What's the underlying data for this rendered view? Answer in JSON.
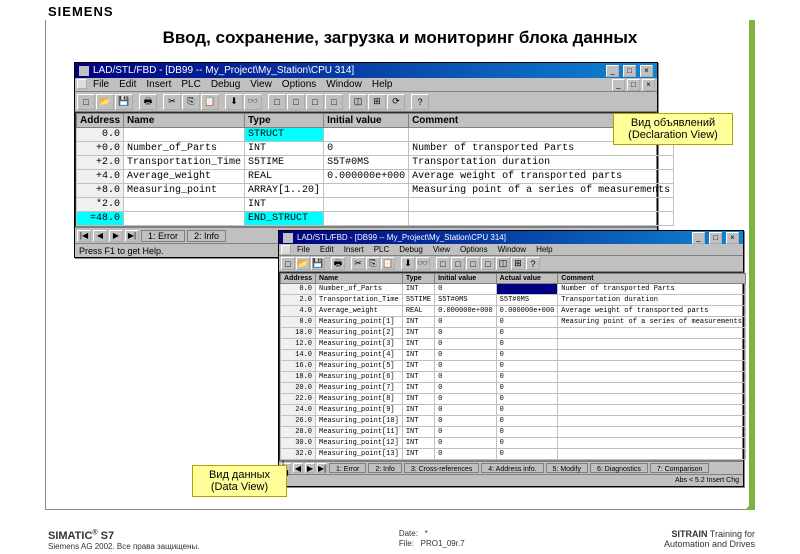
{
  "brand": "SIEMENS",
  "title": "Ввод, сохранение, загрузка и мониторинг блока данных",
  "win1": {
    "title": "LAD/STL/FBD  - [DB99 -- My_Project\\My_Station\\CPU 314]",
    "menu": [
      "File",
      "Edit",
      "Insert",
      "PLC",
      "Debug",
      "View",
      "Options",
      "Window",
      "Help"
    ],
    "cols": [
      "Address",
      "Name",
      "Type",
      "Initial value",
      "Comment"
    ],
    "rows": [
      {
        "addr": "0.0",
        "name": "",
        "type": "STRUCT",
        "init": "",
        "comment": ""
      },
      {
        "addr": "+0.0",
        "name": "Number_of_Parts",
        "type": "INT",
        "init": "0",
        "comment": "Number of transported Parts"
      },
      {
        "addr": "+2.0",
        "name": "Transportation_Time",
        "type": "S5TIME",
        "init": "S5T#0MS",
        "comment": "Transportation duration"
      },
      {
        "addr": "+4.0",
        "name": "Average_weight",
        "type": "REAL",
        "init": "0.000000e+000",
        "comment": "Average weight of transported parts"
      },
      {
        "addr": "+8.0",
        "name": "Measuring_point",
        "type": "ARRAY[1..20]",
        "init": "",
        "comment": "Measuring point of a series of measurements"
      },
      {
        "addr": "*2.0",
        "name": "",
        "type": "INT",
        "init": "",
        "comment": ""
      },
      {
        "addr": "=48.0",
        "name": "",
        "type": "END_STRUCT",
        "init": "",
        "comment": ""
      }
    ],
    "tabs": [
      "1: Error",
      "2: Info"
    ],
    "status": "Press F1 to get Help."
  },
  "win2": {
    "title": "LAD/STL/FBD  - [DB99 -- My_Project\\My_Station\\CPU 314]",
    "menu": [
      "File",
      "Edit",
      "Insert",
      "PLC",
      "Debug",
      "View",
      "Options",
      "Window",
      "Help"
    ],
    "cols": [
      "Address",
      "Name",
      "Type",
      "Initial value",
      "Actual value",
      "Comment"
    ],
    "rows": [
      {
        "addr": "0.0",
        "name": "Number_of_Parts",
        "type": "INT",
        "init": "0",
        "act": "",
        "comment": "Number of transported Parts"
      },
      {
        "addr": "2.0",
        "name": "Transportation_Time",
        "type": "S5TIME",
        "init": "S5T#0MS",
        "act": "S5T#0MS",
        "comment": "Transportation duration"
      },
      {
        "addr": "4.0",
        "name": "Average_weight",
        "type": "REAL",
        "init": "0.000000e+000",
        "act": "0.000000e+000",
        "comment": "Average weight of transported parts"
      },
      {
        "addr": "8.0",
        "name": "Measuring_point[1]",
        "type": "INT",
        "init": "0",
        "act": "0",
        "comment": "Measuring point of a series of measurements"
      },
      {
        "addr": "10.0",
        "name": "Measuring_point[2]",
        "type": "INT",
        "init": "0",
        "act": "0",
        "comment": ""
      },
      {
        "addr": "12.0",
        "name": "Measuring_point[3]",
        "type": "INT",
        "init": "0",
        "act": "0",
        "comment": ""
      },
      {
        "addr": "14.0",
        "name": "Measuring_point[4]",
        "type": "INT",
        "init": "0",
        "act": "0",
        "comment": ""
      },
      {
        "addr": "16.0",
        "name": "Measuring_point[5]",
        "type": "INT",
        "init": "0",
        "act": "0",
        "comment": ""
      },
      {
        "addr": "18.0",
        "name": "Measuring_point[6]",
        "type": "INT",
        "init": "0",
        "act": "0",
        "comment": ""
      },
      {
        "addr": "20.0",
        "name": "Measuring_point[7]",
        "type": "INT",
        "init": "0",
        "act": "0",
        "comment": ""
      },
      {
        "addr": "22.0",
        "name": "Measuring_point[8]",
        "type": "INT",
        "init": "0",
        "act": "0",
        "comment": ""
      },
      {
        "addr": "24.0",
        "name": "Measuring_point[9]",
        "type": "INT",
        "init": "0",
        "act": "0",
        "comment": ""
      },
      {
        "addr": "26.0",
        "name": "Measuring_point[10]",
        "type": "INT",
        "init": "0",
        "act": "0",
        "comment": ""
      },
      {
        "addr": "28.0",
        "name": "Measuring_point[11]",
        "type": "INT",
        "init": "0",
        "act": "0",
        "comment": ""
      },
      {
        "addr": "30.0",
        "name": "Measuring_point[12]",
        "type": "INT",
        "init": "0",
        "act": "0",
        "comment": ""
      },
      {
        "addr": "32.0",
        "name": "Measuring_point[13]",
        "type": "INT",
        "init": "0",
        "act": "0",
        "comment": ""
      }
    ],
    "tabs": [
      "1: Error",
      "2: Info",
      "3: Cross-references",
      "4: Address info.",
      "5: Modify",
      "6: Diagnostics",
      "7: Comparison"
    ],
    "status_right": "Abs < 5.2     Insert  Chg"
  },
  "annots": {
    "decl1": "Вид объявлений",
    "decl2": "(Declaration View)",
    "data1": "Вид данных",
    "data2": "(Data View)"
  },
  "footer": {
    "left1": "SIMATIC",
    "left1sup": "®",
    "left1b": " S7",
    "left2": "Siemens AG 2002. Все права защищены.",
    "mid1": "Date:",
    "mid1v": "*",
    "mid2": "File:",
    "mid2v": "PRO1_09r.7",
    "right1": "SITRAIN",
    "right2": " Training for",
    "right3": "Automation and Drives"
  }
}
